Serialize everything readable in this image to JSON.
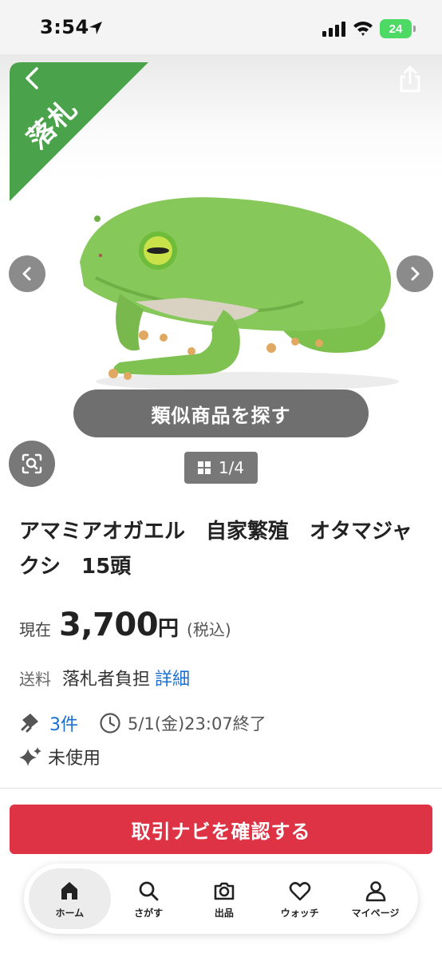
{
  "status_bar": {
    "time": "3:54",
    "battery": "24"
  },
  "hero": {
    "sold_label": "落札",
    "similar_button_label": "類似商品を探す",
    "page_counter": "1/4"
  },
  "item": {
    "title": "アマミアオガエル　自家繁殖　オタマジャクシ　15頭",
    "price_label": "現在",
    "price_value": "3,700",
    "price_unit": "円",
    "tax_note": "(税込)",
    "shipping_label": "送料",
    "shipping_value": "落札者負担",
    "shipping_link": "詳細",
    "bid_count": "3件",
    "end_time": "5/1(金)23:07終了",
    "condition": "未使用"
  },
  "cta": {
    "label": "取引ナビを確認する"
  },
  "bottom_nav": {
    "items": [
      {
        "label": "ホーム",
        "icon": "home-icon"
      },
      {
        "label": "さがす",
        "icon": "search-icon"
      },
      {
        "label": "出品",
        "icon": "camera-icon"
      },
      {
        "label": "ウォッチ",
        "icon": "heart-icon"
      },
      {
        "label": "マイページ",
        "icon": "person-icon"
      }
    ]
  },
  "colors": {
    "accent_red": "#dd3345",
    "sold_green": "#4aa34a",
    "link_blue": "#1a6fd1",
    "battery_green": "#4cd964"
  }
}
